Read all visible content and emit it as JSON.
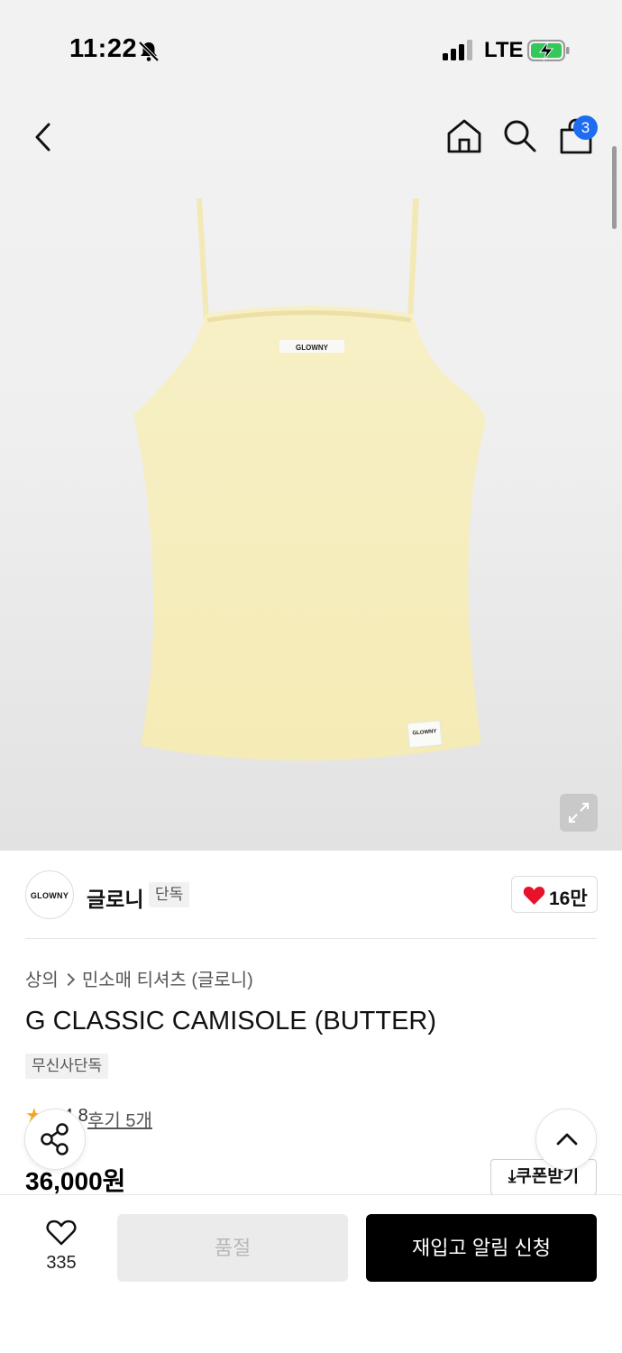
{
  "status_bar": {
    "time": "11:22",
    "network": "LTE"
  },
  "header": {
    "cart_count": "3"
  },
  "product_image": {
    "label_text": "GLOWNY",
    "color": "#f6edbd"
  },
  "brand": {
    "logo_text": "GLOWNY",
    "name": "글로니",
    "tag": "단독",
    "likes": "16만"
  },
  "breadcrumb": {
    "category": "상의",
    "subcategory": "민소매 티셔츠 (글로니)"
  },
  "product": {
    "title": "G CLASSIC CAMISOLE (BUTTER)",
    "badge": "무신사단독",
    "rating": "4.8",
    "reviews": "후기 5개",
    "price": "36,000원",
    "coupon_label": "쿠폰받기"
  },
  "bottom_bar": {
    "wish_count": "335",
    "soldout_label": "품절",
    "restock_label": "재입고 알림 신청"
  },
  "colors": {
    "accent": "#1e6cf0",
    "heart": "#e8132b",
    "primary_button": "#000000"
  }
}
